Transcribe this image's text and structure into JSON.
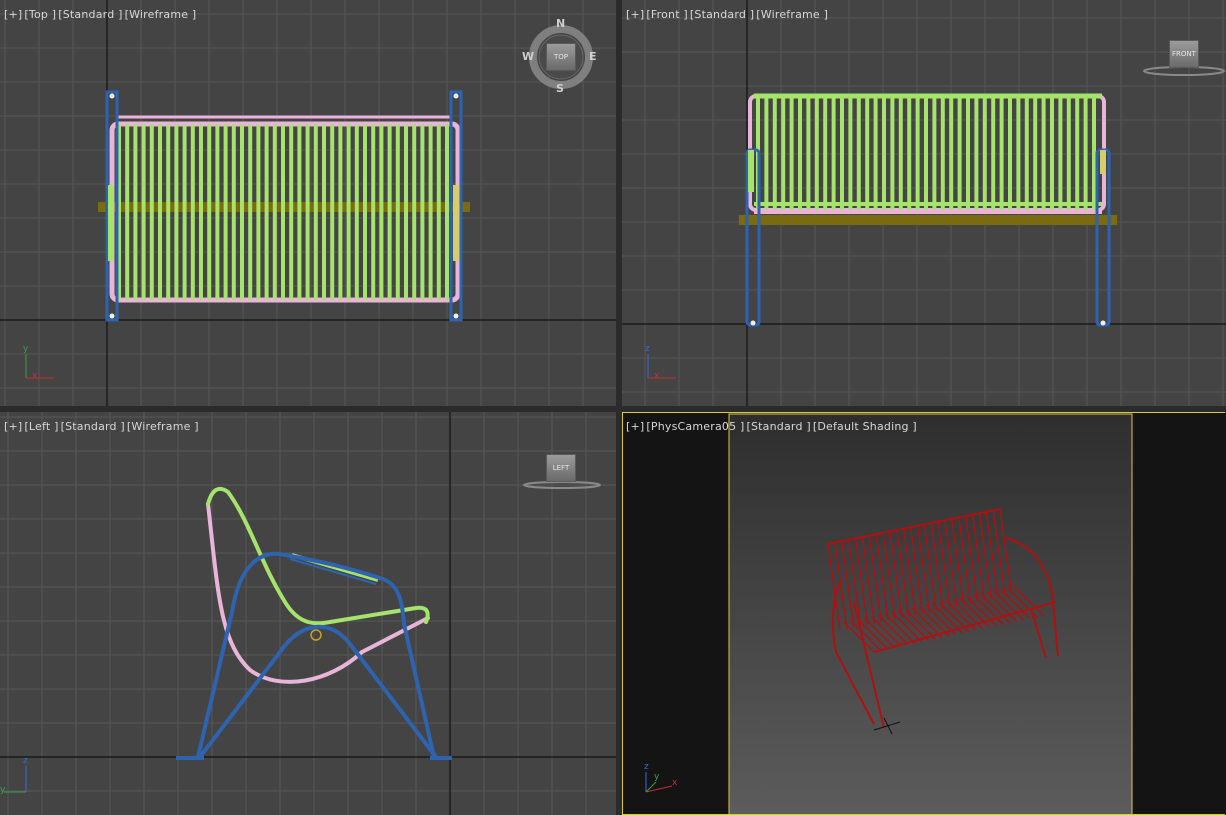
{
  "viewports": {
    "top": {
      "label_parts": [
        "[+]",
        "[Top ]",
        "[Standard ]",
        "[Wireframe ]"
      ],
      "viewcube_label": "TOP",
      "compass": {
        "n": "N",
        "s": "S",
        "e": "E",
        "w": "W"
      },
      "axis": {
        "a": "y",
        "b": "x"
      }
    },
    "front": {
      "label_parts": [
        "[+]",
        "[Front ]",
        "[Standard ]",
        "[Wireframe ]"
      ],
      "viewcube_label": "FRONT",
      "axis": {
        "a": "z",
        "b": "x"
      }
    },
    "left": {
      "label_parts": [
        "[+]",
        "[Left ]",
        "[Standard ]",
        "[Wireframe ]"
      ],
      "viewcube_label": "LEFT",
      "axis": {
        "a": "z",
        "b": "y"
      }
    },
    "camera": {
      "label_parts": [
        "[+]",
        "[PhysCamera05 ]",
        "[Standard ]",
        "[Default Shading ]"
      ],
      "axis": {
        "a": "z",
        "b": "x",
        "c": "y"
      }
    }
  },
  "colors": {
    "viewport_bg": "#444444",
    "grid": "#575757",
    "world_axis": "#111111",
    "slat_green": "#a6e36b",
    "frame_pink": "#e8b4d8",
    "leg_blue": "#2e63b0",
    "bar_olive": "#7a6a10",
    "arm_yellow": "#d8cc6a",
    "render_red": "#b01010",
    "active_border": "#d9c84a"
  }
}
